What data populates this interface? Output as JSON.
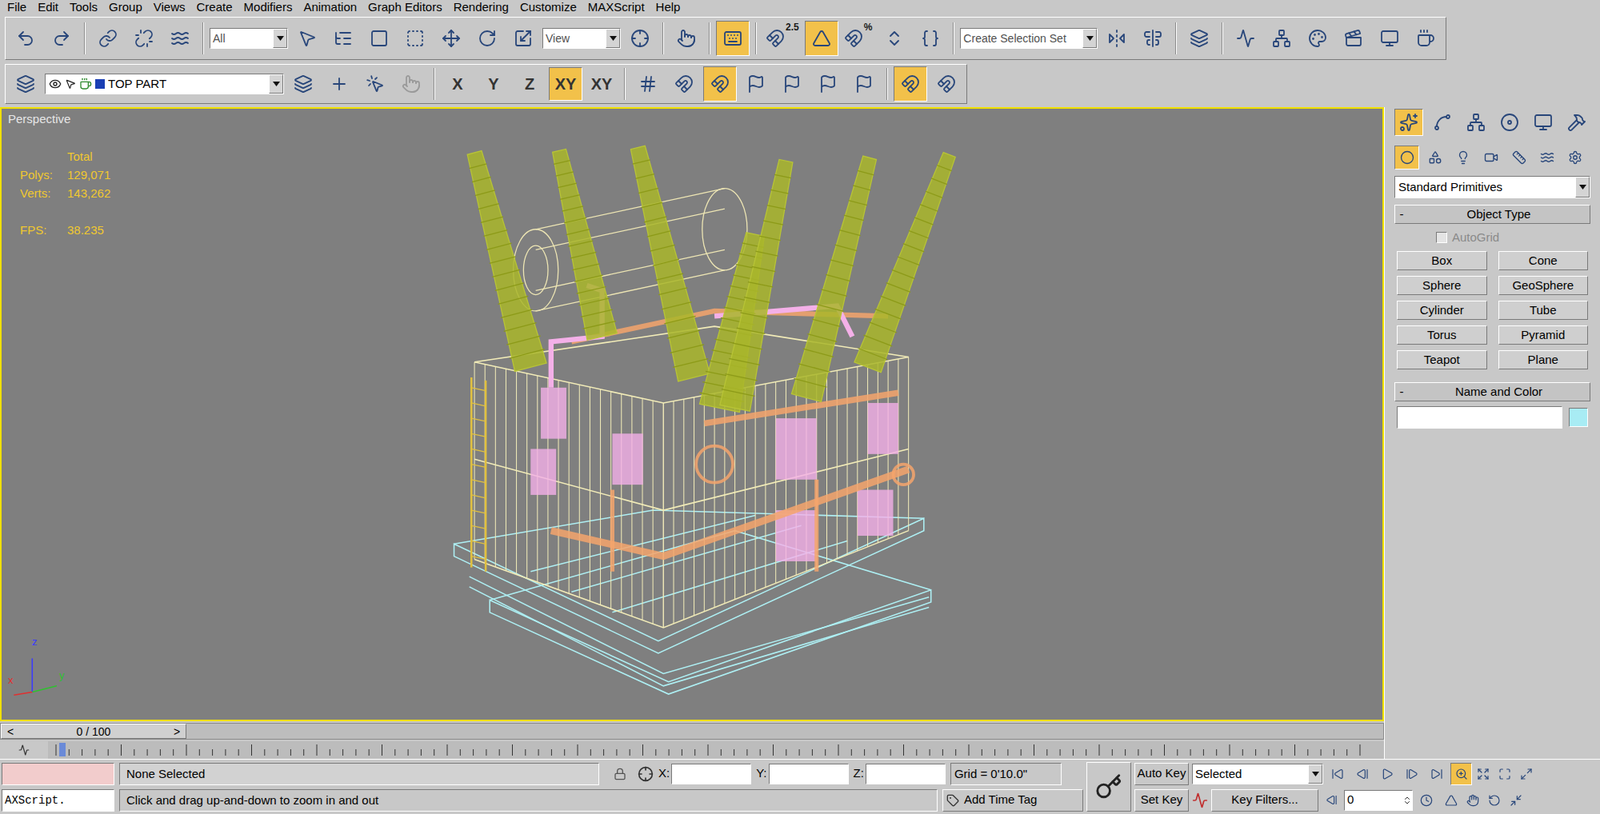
{
  "menu": [
    "File",
    "Edit",
    "Tools",
    "Group",
    "Views",
    "Create",
    "Modifiers",
    "Animation",
    "Graph Editors",
    "Rendering",
    "Customize",
    "MAXScript",
    "Help"
  ],
  "main_toolbar": [
    {
      "kind": "button",
      "selected": false
    },
    {
      "kind": "button",
      "selected": false
    },
    {
      "kind": "button",
      "selected": false
    },
    {
      "kind": "button",
      "selected": false
    },
    {
      "kind": "button",
      "selected": false
    },
    {
      "kind": "dropdown",
      "value": "All"
    },
    {
      "kind": "button",
      "selected": false
    },
    {
      "kind": "button",
      "selected": false
    },
    {
      "kind": "button",
      "selected": false
    },
    {
      "kind": "button",
      "selected": false
    },
    {
      "kind": "button",
      "selected": false
    },
    {
      "kind": "button",
      "selected": false
    },
    {
      "kind": "button",
      "selected": false
    },
    {
      "kind": "dropdown",
      "value": "View"
    },
    {
      "kind": "button",
      "selected": false
    },
    {
      "kind": "button",
      "selected": false
    },
    {
      "kind": "button",
      "selected": true
    },
    {
      "kind": "button",
      "selected": false,
      "label": "2.5"
    },
    {
      "kind": "button",
      "selected": true
    },
    {
      "kind": "button",
      "selected": false,
      "label": "%"
    },
    {
      "kind": "button",
      "selected": false
    },
    {
      "kind": "button",
      "selected": false
    },
    {
      "kind": "dropdown",
      "value": "Create Selection Set"
    },
    {
      "kind": "button",
      "selected": false
    },
    {
      "kind": "button",
      "selected": false
    },
    {
      "kind": "button",
      "selected": false
    },
    {
      "kind": "button",
      "selected": false
    },
    {
      "kind": "button",
      "selected": false
    },
    {
      "kind": "button",
      "selected": false
    },
    {
      "kind": "button",
      "selected": false
    },
    {
      "kind": "button",
      "selected": false
    },
    {
      "kind": "button",
      "selected": false
    }
  ],
  "layer_toolbar": {
    "layer": {
      "name": "TOP PART",
      "color": "#1b3fb4"
    },
    "layer_buttons": [
      {
        "disabled": false
      },
      {
        "disabled": false
      },
      {
        "disabled": false
      },
      {
        "disabled": true
      }
    ],
    "axis_buttons": [
      {
        "label": "X",
        "selected": false
      },
      {
        "label": "Y",
        "selected": false
      },
      {
        "label": "Z",
        "selected": false
      },
      {
        "label": "XY",
        "selected": true
      },
      {
        "label": "XY",
        "selected": false
      }
    ],
    "snap_buttons": [
      {
        "selected": false
      },
      {
        "selected": false
      },
      {
        "selected": true
      },
      {
        "selected": false
      },
      {
        "selected": false
      },
      {
        "selected": false
      },
      {
        "selected": false
      }
    ],
    "extra_buttons": [
      {
        "selected": true
      },
      {
        "selected": false
      }
    ]
  },
  "viewport": {
    "label": "Perspective",
    "stats": {
      "title": "Total",
      "rows": [
        {
          "label": "Polys:",
          "value": "129,071"
        },
        {
          "label": "Verts:",
          "value": "143,262"
        }
      ],
      "fps": {
        "label": "FPS:",
        "value": "38.235"
      }
    },
    "axis_labels": {
      "z": "z",
      "x": "x",
      "y": "y"
    }
  },
  "command_panel": {
    "tabs": [
      {
        "selected": true
      },
      {
        "selected": false
      },
      {
        "selected": false
      },
      {
        "selected": false
      },
      {
        "selected": false
      },
      {
        "selected": false
      }
    ],
    "subtabs": [
      {
        "selected": true
      },
      {
        "selected": false
      },
      {
        "selected": false
      },
      {
        "selected": false
      },
      {
        "selected": false
      },
      {
        "selected": false
      },
      {
        "selected": false
      }
    ],
    "category": "Standard Primitives",
    "object_type": {
      "collapse": "-",
      "title": "Object Type",
      "autogrid": {
        "label": "AutoGrid",
        "checked": false,
        "disabled": true
      },
      "buttons": [
        "Box",
        "Cone",
        "Sphere",
        "GeoSphere",
        "Cylinder",
        "Tube",
        "Torus",
        "Pyramid",
        "Teapot",
        "Plane"
      ]
    },
    "name_and_color": {
      "collapse": "-",
      "title": "Name and Color",
      "name": "",
      "color": "#a8ecf4"
    }
  },
  "timeline": {
    "position": "0 / 100",
    "prev": "<",
    "next": ">",
    "level": 0
  },
  "status": {
    "listener_top": "",
    "listener_bottom": "AXScript.",
    "selection": "None Selected",
    "coords": [
      {
        "label": "X:",
        "value": ""
      },
      {
        "label": "Y:",
        "value": ""
      },
      {
        "label": "Z:",
        "value": ""
      }
    ],
    "grid": "Grid = 0'10.0\"",
    "prompt": "Click and drag up-and-down to zoom in and out",
    "time_tag": "Add Time Tag",
    "auto_key": "Auto Key",
    "key_mode": "Selected",
    "set_key": "Set Key",
    "key_filters": "Key Filters...",
    "frame": "0",
    "nav_buttons": [
      {
        "selected": true
      },
      {
        "selected": false
      },
      {
        "selected": false
      },
      {
        "selected": false
      },
      {
        "selected": false
      },
      {
        "selected": false
      },
      {
        "selected": false
      },
      {
        "selected": false
      }
    ]
  }
}
